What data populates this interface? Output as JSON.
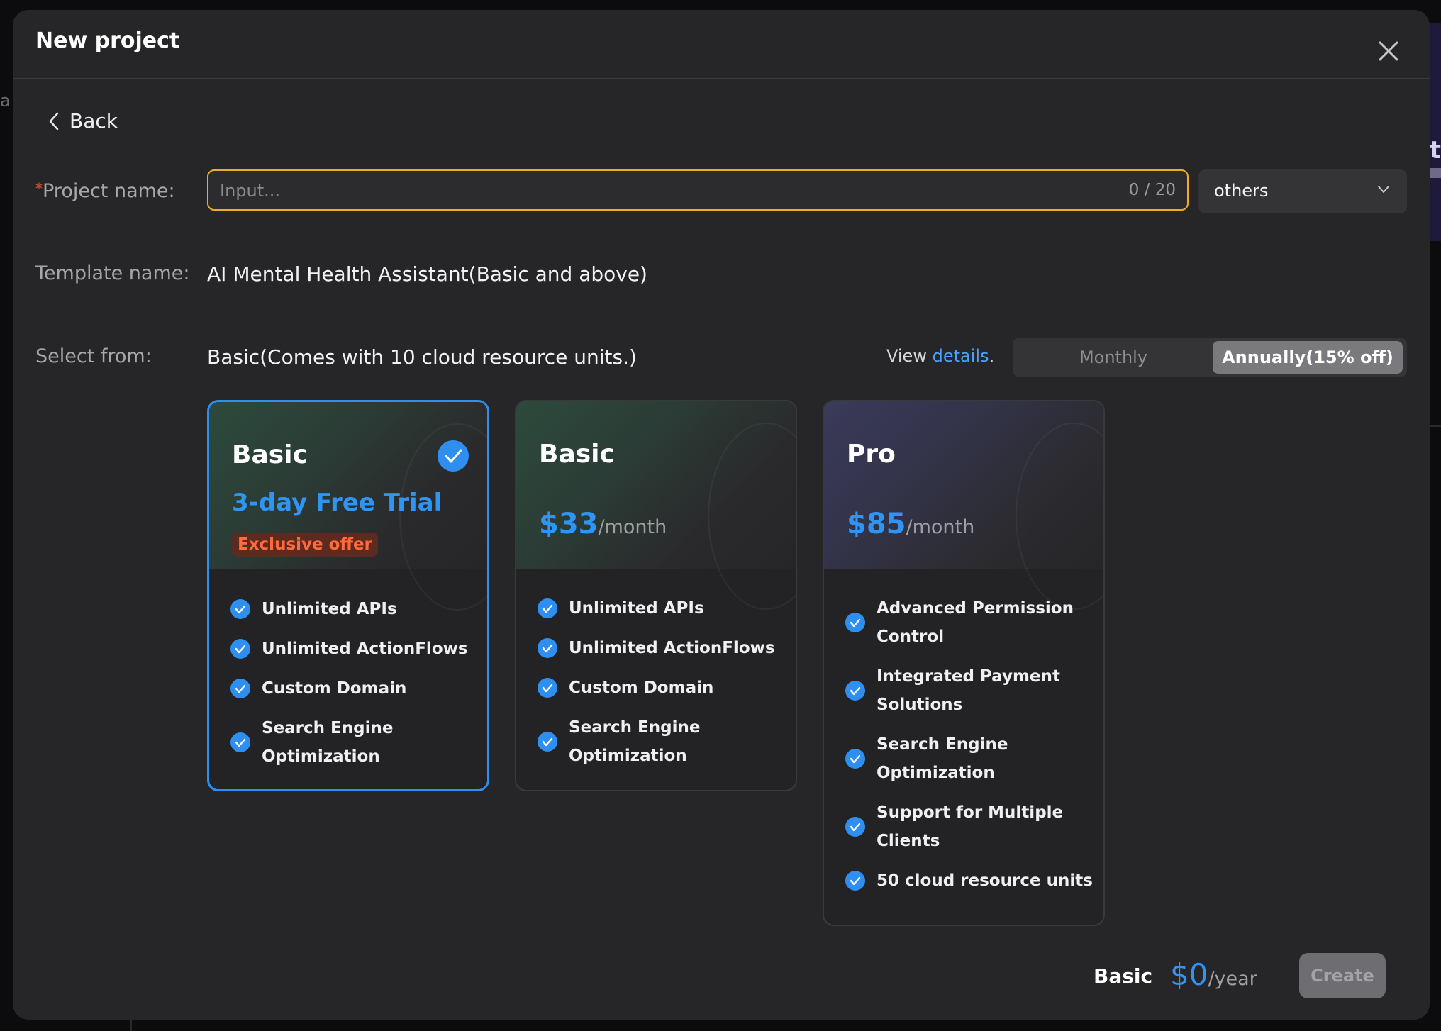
{
  "background": {
    "left_fragment": "a",
    "right_fragment": "t"
  },
  "dialog": {
    "title": "New project",
    "back_label": "Back"
  },
  "project_name": {
    "required_mark": "*",
    "label": "Project name:",
    "placeholder": "Input...",
    "counter": "0 / 20",
    "category_value": "others"
  },
  "template": {
    "label": "Template name:",
    "value": "AI Mental Health Assistant(Basic and above)"
  },
  "select_from": {
    "label": "Select from:",
    "value": "Basic(Comes with 10 cloud resource units.)",
    "view_prefix": "View ",
    "details_link": "details",
    "view_suffix": ".",
    "billing_options": [
      "Monthly",
      "Annually(15% off)"
    ],
    "billing_selected": "Annually(15% off)"
  },
  "plans": [
    {
      "name": "Basic",
      "selected": true,
      "trial_text": "3-day Free Trial",
      "offer_badge": "Exclusive offer",
      "features": [
        "Unlimited APIs",
        "Unlimited ActionFlows",
        "Custom Domain",
        "Search Engine Optimization"
      ]
    },
    {
      "name": "Basic",
      "selected": false,
      "price": "$33",
      "period": "/month",
      "features": [
        "Unlimited APIs",
        "Unlimited ActionFlows",
        "Custom Domain",
        "Search Engine Optimization"
      ]
    },
    {
      "name": "Pro",
      "selected": false,
      "price": "$85",
      "period": "/month",
      "features": [
        "Advanced Permission Control",
        "Integrated Payment Solutions",
        "Search Engine Optimization",
        "Support for Multiple Clients",
        "50 cloud resource units"
      ]
    }
  ],
  "footer": {
    "plan_name": "Basic",
    "price": "$0",
    "period": "/year",
    "create_label": "Create"
  },
  "colors": {
    "accent": "#2f95f5",
    "input_border": "#f1ac1f",
    "offer_text": "#ff6b3d",
    "modal_bg": "#262628"
  },
  "icons": [
    "close-icon",
    "chevron-left-icon",
    "chevron-down-icon",
    "check-circle-icon"
  ]
}
